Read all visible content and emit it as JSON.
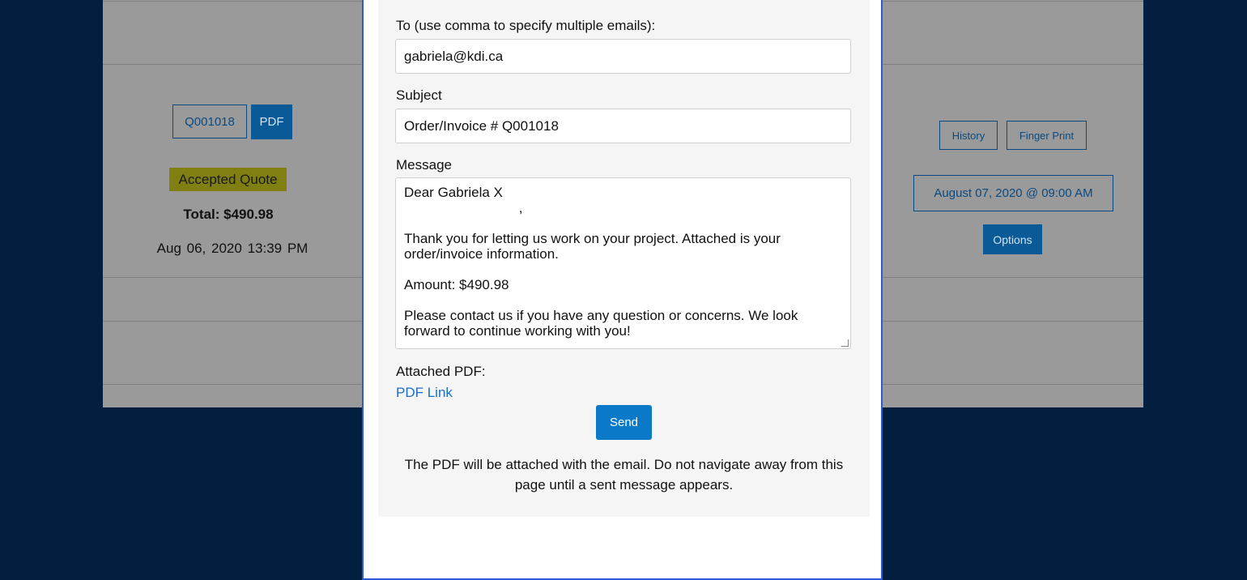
{
  "background_page": {
    "quote_number_button": "Q001018",
    "pdf_button": "PDF",
    "status_badge": "Accepted Quote",
    "total": "Total: $490.98",
    "date": "Aug 06, 2020",
    "time": "13:39 PM",
    "history_button": "History",
    "fingerprint_button": "Finger Print",
    "appointment_button": "August 07, 2020 @ 09:00 AM",
    "options_button": "Options"
  },
  "email_modal": {
    "to_label": "To (use comma to specify multiple emails):",
    "to_value": "gabriela@kdi.ca",
    "subject_label": "Subject",
    "subject_value": "Order/Invoice # Q001018",
    "message_label": "Message",
    "message": {
      "greeting": "Dear Gabriela X",
      "comma_line": "                              ,",
      "paragraph1": "Thank you for letting us work on your project. Attached is your order/invoice information.",
      "amount": "Amount: $490.98",
      "paragraph2": "Please contact us if you have any question or concerns. We look forward to continue working with you!"
    },
    "attached_label": "Attached PDF:",
    "pdf_link": "PDF Link",
    "send_button": "Send",
    "notice": "The PDF will be attached with the email. Do not navigate away from this page until a sent message appears."
  },
  "colors": {
    "backdrop": "#031f3f",
    "modal_border": "#2a5bd7",
    "primary_button": "#0a7ac8",
    "link": "#1a6fc4"
  }
}
